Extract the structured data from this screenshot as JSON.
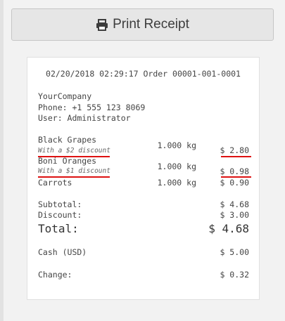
{
  "print_button": {
    "label": "Print Receipt",
    "icon": "printer-icon"
  },
  "receipt": {
    "header": "02/20/2018 02:29:17 Order 00001-001-0001",
    "company": "YourCompany",
    "phone": "Phone: +1 555 123 8069",
    "user": "User: Administrator",
    "items": [
      {
        "name": "Black Grapes",
        "discount": "With a $2 discount",
        "qty": "1.000 kg",
        "price": "$ 2.80"
      },
      {
        "name": "Boni Oranges",
        "discount": "With a $1 discount",
        "qty": "1.000 kg",
        "price": "$ 0.98"
      },
      {
        "name": "Carrots",
        "qty": "1.000 kg",
        "price": "$ 0.90"
      }
    ],
    "subtotal_label": "Subtotal:",
    "subtotal_value": "$ 4.68",
    "discount_label": "Discount:",
    "discount_value": "$ 3.00",
    "total_label": "Total:",
    "total_value": "$ 4.68",
    "cash_label": "Cash (USD)",
    "cash_value": "$ 5.00",
    "change_label": "Change:",
    "change_value": "$ 0.32"
  },
  "colors": {
    "annotation_underline": "#dd1111"
  }
}
